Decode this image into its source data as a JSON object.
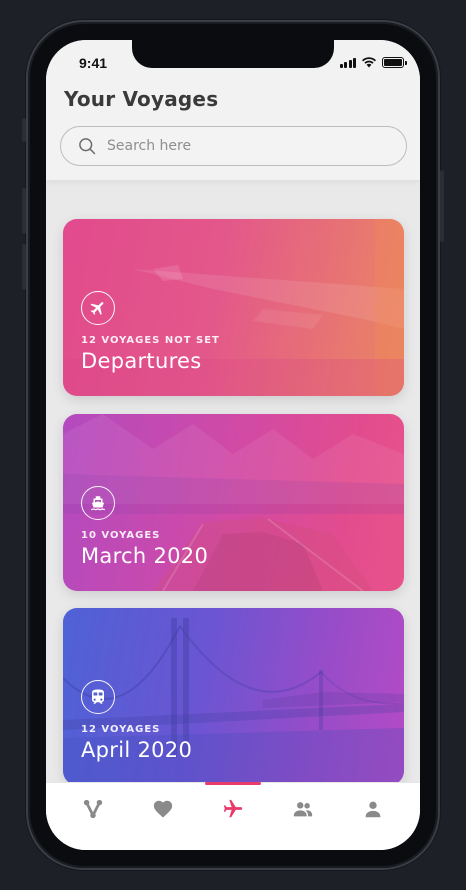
{
  "status_bar": {
    "time": "9:41"
  },
  "header": {
    "title": "Your Voyages"
  },
  "search": {
    "placeholder": "Search here"
  },
  "cards": [
    {
      "subtitle": "12 VOYAGES NOT SET",
      "title": "Departures",
      "icon": "airplane-icon"
    },
    {
      "subtitle": "10 VOYAGES",
      "title": "March 2020",
      "icon": "ship-icon"
    },
    {
      "subtitle": "12 VOYAGES",
      "title": "April 2020",
      "icon": "train-icon"
    }
  ],
  "tabs": [
    {
      "icon": "routes-icon",
      "active": false
    },
    {
      "icon": "heart-icon",
      "active": false
    },
    {
      "icon": "airplane-icon",
      "active": true
    },
    {
      "icon": "group-icon",
      "active": false
    },
    {
      "icon": "profile-icon",
      "active": false
    }
  ],
  "colors": {
    "accent": "#e83a6b",
    "inactive_icon": "#8a8a8a",
    "title_text": "#3a3a3a"
  }
}
